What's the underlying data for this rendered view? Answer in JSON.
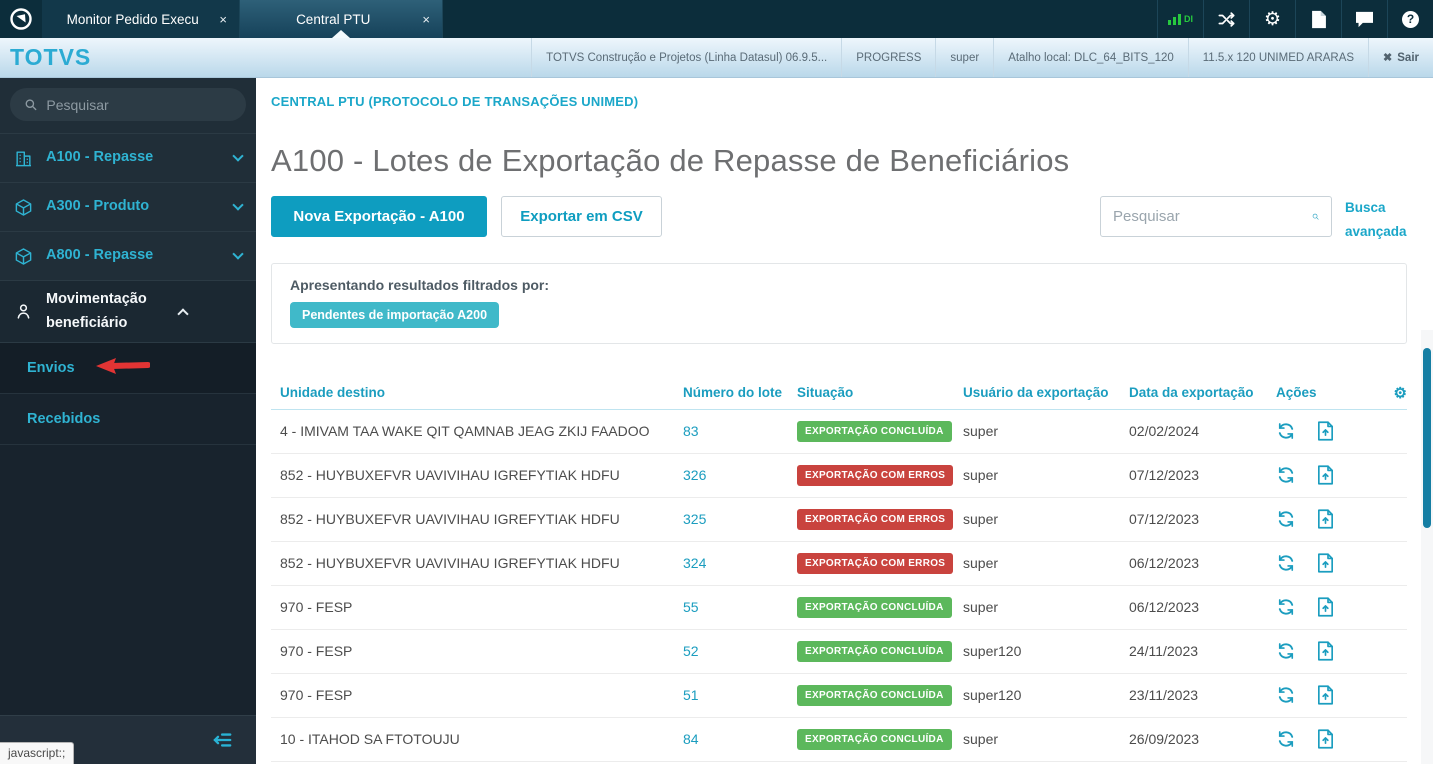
{
  "icons": {
    "tab_close": "×",
    "logout_x": "✖",
    "gear": "⚙"
  },
  "tabbar": {
    "tabs": [
      {
        "label": "Monitor Pedido Execu",
        "active": false
      },
      {
        "label": "Central PTU",
        "active": true
      }
    ],
    "di_label": "DI",
    "help_label": "?"
  },
  "header": {
    "brand": "TOTVS",
    "env_items": [
      "TOTVS Construção e Projetos (Linha Datasul) 06.9.5...",
      "PROGRESS",
      "super",
      "Atalho local: DLC_64_BITS_120",
      "11.5.x 120 UNIMED ARARAS"
    ],
    "logout_label": "Sair"
  },
  "sidebar": {
    "search_placeholder": "Pesquisar",
    "items": [
      {
        "label": "A100 - Repasse",
        "icon": "building-icon",
        "state": "collapsed"
      },
      {
        "label": "A300 - Produto",
        "icon": "cube-icon",
        "state": "collapsed"
      },
      {
        "label": "A800 - Repasse",
        "icon": "cube-icon",
        "state": "collapsed"
      },
      {
        "label": "Movimentação beneficiário",
        "icon": "person-icon",
        "state": "expanded"
      }
    ],
    "subitems": [
      {
        "label": "Envios",
        "active": true,
        "annotated": true
      },
      {
        "label": "Recebidos",
        "active": false,
        "annotated": false
      }
    ],
    "status_tooltip": "javascript:;"
  },
  "main": {
    "breadcrumb": "CENTRAL PTU (PROTOCOLO DE TRANSAÇÕES UNIMED)",
    "title": "A100 - Lotes de Exportação de Repasse de Beneficiários",
    "primary_button": "Nova Exportação - A100",
    "secondary_button": "Exportar em CSV",
    "search_placeholder": "Pesquisar",
    "advanced_search": "Busca avançada",
    "filter_label": "Apresentando resultados filtrados por:",
    "filter_chip": "Pendentes de importação A200"
  },
  "table": {
    "columns": [
      "Unidade destino",
      "Número do lote",
      "Situação",
      "Usuário da exportação",
      "Data da exportação",
      "Ações"
    ],
    "status_colors": {
      "success": "#5cb85c",
      "error": "#c9433e"
    },
    "rows": [
      {
        "unit": "4 - IMIVAM TAA WAKE QIT QAMNAB JEAG ZKIJ FAADOO",
        "lot": "83",
        "status": "EXPORTAÇÃO CONCLUÍDA",
        "status_type": "success",
        "user": "super",
        "date": "02/02/2024"
      },
      {
        "unit": "852 - HUYBUXEFVR UAVIVIHAU IGREFYTIAK HDFU",
        "lot": "326",
        "status": "EXPORTAÇÃO COM ERROS",
        "status_type": "error",
        "user": "super",
        "date": "07/12/2023"
      },
      {
        "unit": "852 - HUYBUXEFVR UAVIVIHAU IGREFYTIAK HDFU",
        "lot": "325",
        "status": "EXPORTAÇÃO COM ERROS",
        "status_type": "error",
        "user": "super",
        "date": "07/12/2023"
      },
      {
        "unit": "852 - HUYBUXEFVR UAVIVIHAU IGREFYTIAK HDFU",
        "lot": "324",
        "status": "EXPORTAÇÃO COM ERROS",
        "status_type": "error",
        "user": "super",
        "date": "06/12/2023"
      },
      {
        "unit": "970 - FESP",
        "lot": "55",
        "status": "EXPORTAÇÃO CONCLUÍDA",
        "status_type": "success",
        "user": "super",
        "date": "06/12/2023"
      },
      {
        "unit": "970 - FESP",
        "lot": "52",
        "status": "EXPORTAÇÃO CONCLUÍDA",
        "status_type": "success",
        "user": "super120",
        "date": "24/11/2023"
      },
      {
        "unit": "970 - FESP",
        "lot": "51",
        "status": "EXPORTAÇÃO CONCLUÍDA",
        "status_type": "success",
        "user": "super120",
        "date": "23/11/2023"
      },
      {
        "unit": "10 - ITAHOD SA FTOTOUJU",
        "lot": "84",
        "status": "EXPORTAÇÃO CONCLUÍDA",
        "status_type": "success",
        "user": "super",
        "date": "26/09/2023"
      }
    ]
  },
  "colors": {
    "accent": "#0e9dc0",
    "link": "#1b9dbf",
    "sidebar_bg": "#202e38",
    "tabbar_bg": "#0c2d3b"
  }
}
